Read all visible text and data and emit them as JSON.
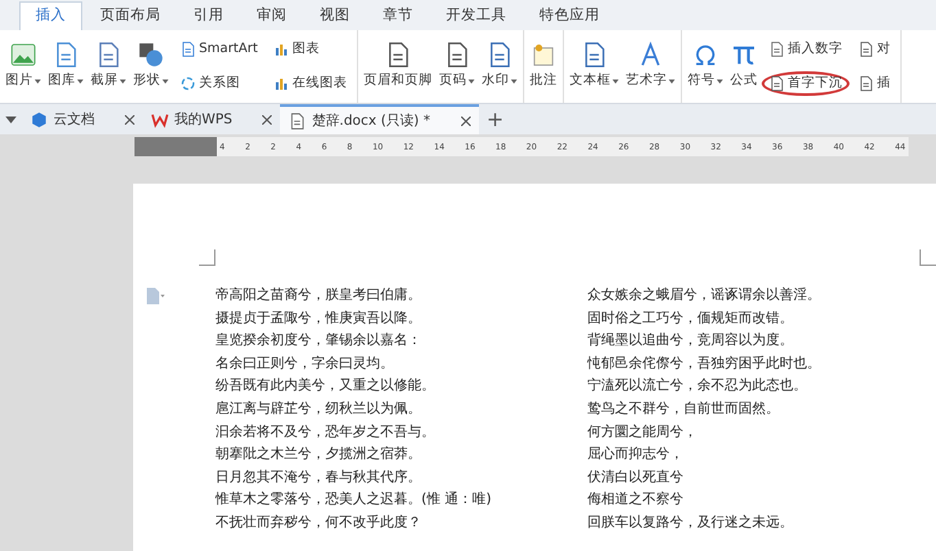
{
  "menu_tabs": [
    {
      "label": "插入",
      "selected": true
    },
    {
      "label": "页面布局",
      "selected": false
    },
    {
      "label": "引用",
      "selected": false
    },
    {
      "label": "审阅",
      "selected": false
    },
    {
      "label": "视图",
      "selected": false
    },
    {
      "label": "章节",
      "selected": false
    },
    {
      "label": "开发工具",
      "selected": false
    },
    {
      "label": "特色应用",
      "selected": false
    }
  ],
  "ribbon": [
    {
      "items": [
        {
          "kind": "large",
          "label": "图片",
          "dropdown": true
        },
        {
          "kind": "large",
          "label": "图库",
          "dropdown": true
        },
        {
          "kind": "large",
          "label": "截屏",
          "dropdown": true
        },
        {
          "kind": "large",
          "label": "形状",
          "dropdown": true
        },
        {
          "kind": "small",
          "top": {
            "label": "SmartArt"
          },
          "bottom": {
            "label": "关系图"
          }
        },
        {
          "kind": "small",
          "top": {
            "label": "图表"
          },
          "bottom": {
            "label": "在线图表"
          }
        }
      ]
    },
    {
      "items": [
        {
          "kind": "large",
          "label": "页眉和页脚",
          "dropdown": false
        },
        {
          "kind": "large",
          "label": "页码",
          "dropdown": true
        },
        {
          "kind": "large",
          "label": "水印",
          "dropdown": true
        }
      ]
    },
    {
      "items": [
        {
          "kind": "large",
          "label": "批注",
          "dropdown": false
        }
      ]
    },
    {
      "items": [
        {
          "kind": "large",
          "label": "文本框",
          "dropdown": true
        },
        {
          "kind": "large",
          "label": "艺术字",
          "dropdown": true
        }
      ]
    },
    {
      "items": [
        {
          "kind": "large",
          "label": "符号",
          "dropdown": true
        },
        {
          "kind": "large",
          "label": "公式",
          "dropdown": false
        },
        {
          "kind": "small",
          "top": {
            "label": "插入数字",
            "circled": false
          },
          "bottom": {
            "label": "首字下沉",
            "circled": true
          }
        },
        {
          "kind": "small",
          "top": {
            "label": "对"
          },
          "bottom": {
            "label": "插"
          }
        }
      ]
    }
  ],
  "doc_tabs": [
    {
      "label": "云文档",
      "selected": false
    },
    {
      "label": "我的WPS",
      "selected": false
    },
    {
      "label": "楚辞.docx (只读) *",
      "selected": true
    }
  ],
  "new_tab": "+",
  "ruler": [
    "4",
    "2",
    "2",
    "4",
    "6",
    "8",
    "10",
    "12",
    "14",
    "16",
    "18",
    "20",
    "22",
    "24",
    "26",
    "28",
    "30",
    "32",
    "34",
    "36",
    "38",
    "40",
    "42",
    "44"
  ],
  "document": {
    "columns": [
      [
        "帝高阳之苗裔兮，朕皇考曰伯庸。",
        "摄提贞于孟陬兮，惟庚寅吾以降。",
        "皇览揆余初度兮，肇锡余以嘉名：",
        "名余曰正则兮，字余曰灵均。",
        "纷吾既有此内美兮，又重之以修能。",
        "扈江离与辟芷兮，纫秋兰以为佩。",
        "汩余若将不及兮，恐年岁之不吾与。",
        "朝搴阰之木兰兮，夕揽洲之宿莽。",
        "日月忽其不淹兮，春与秋其代序。",
        "惟草木之零落兮，恐美人之迟暮。(惟 通：唯)",
        "不抚壮而弃秽兮，何不改乎此度？"
      ],
      [
        "众女嫉余之蛾眉兮，谣诼谓余以善淫。",
        "固时俗之工巧兮，偭规矩而改错。",
        "背绳墨以追曲兮，竞周容以为度。",
        "忳郁邑余侘傺兮，吾独穷困乎此时也。",
        "宁溘死以流亡兮，余不忍为此态也。",
        "鸷鸟之不群兮，自前世而固然。",
        "何方圜之能周兮，",
        "屈心而抑志兮，",
        "伏清白以死直兮",
        "侮相道之不察兮",
        "回朕车以复路兮，及行迷之未远。"
      ]
    ]
  }
}
